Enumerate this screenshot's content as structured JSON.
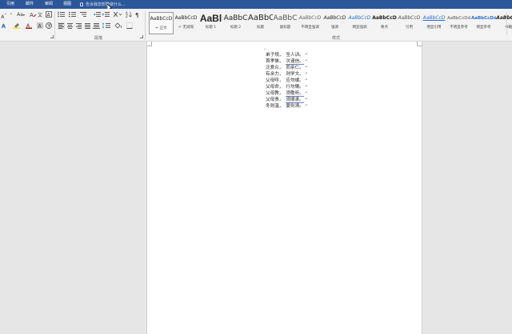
{
  "tabs": [
    "引用",
    "邮件",
    "审阅",
    "视图"
  ],
  "tell_me": "告诉我您想要做什么...",
  "ribbon": {
    "font_size_label": "Aa",
    "paragraph_group_label": "段落",
    "styles_group_label": "样式",
    "styles": [
      {
        "preview": "AaBbCcD",
        "name": "↵ 正文",
        "selected": true
      },
      {
        "preview": "AaBbCcD",
        "name": "↵ 无间隔"
      },
      {
        "preview": "AaBl",
        "name": "标题 1"
      },
      {
        "preview": "AaBbC",
        "name": "标题 2"
      },
      {
        "preview": "AaBbC",
        "name": "标题"
      },
      {
        "preview": "AaBbC",
        "name": "副标题"
      },
      {
        "preview": "AaBbCcD",
        "name": "不明显强调"
      },
      {
        "preview": "AaBbCcD",
        "name": "强调"
      },
      {
        "preview": "AaBbCcD",
        "name": "明显强调"
      },
      {
        "preview": "AaBbCcD",
        "name": "要点"
      },
      {
        "preview": "AaBbCcD",
        "name": "引用"
      },
      {
        "preview": "AaBbCcD",
        "name": "明显引用"
      },
      {
        "preview": "AaBbCcDd",
        "name": "不明显参考"
      },
      {
        "preview": "AaBbCcDd",
        "name": "明显参考"
      },
      {
        "preview": "AaBbCcD",
        "name": "书籍"
      }
    ]
  },
  "document": {
    "top_mark": "↵",
    "lines": [
      {
        "a": "弟子规，",
        "b": "圣人训。",
        "ub": false
      },
      {
        "a": "首孝悌，",
        "b": "次谨信。",
        "ub": true
      },
      {
        "a": "泛爱众，",
        "b": "而亲仁。",
        "ub": false
      },
      {
        "a": "有余力，",
        "b": "则学文。",
        "ub": false
      },
      {
        "a": "父母呼，",
        "b": "应勿缓。",
        "ub": false
      },
      {
        "a": "父母命，",
        "b": "行勿懒。",
        "ub": false
      },
      {
        "a": "父母教，",
        "b": "须敬听。",
        "ub": true
      },
      {
        "a": "父母责，",
        "b": "须顺承。",
        "ub": true
      },
      {
        "a": "冬则温，",
        "b": "夏则凊。",
        "ub": false
      }
    ],
    "para_mark": "↵"
  },
  "colors": {
    "tabbar": "#2b579a",
    "ribbon": "#f3f3f3",
    "workspace": "#e6e6e6",
    "underline": "#6c86c4",
    "highlight": "#ffe600",
    "font_color": "#c00000"
  }
}
